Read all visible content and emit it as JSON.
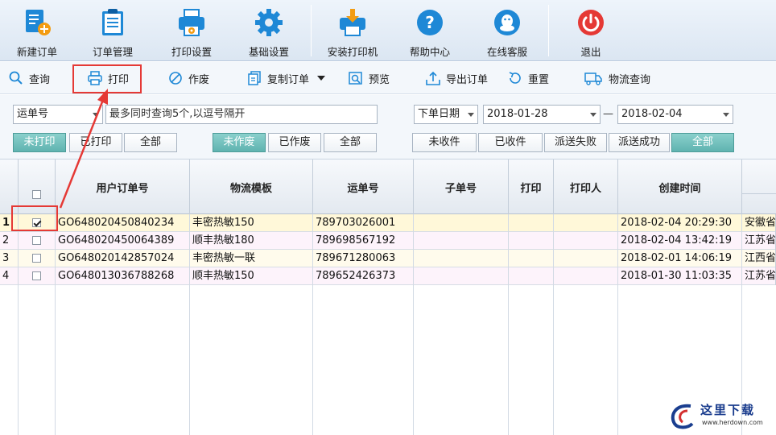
{
  "toolbar": {
    "buttons": [
      {
        "label": "新建订单",
        "icon": "new-order-icon"
      },
      {
        "label": "订单管理",
        "icon": "clipboard-icon"
      },
      {
        "label": "打印设置",
        "icon": "printer-settings-icon"
      },
      {
        "label": "基础设置",
        "icon": "gear-icon"
      },
      {
        "label": "安装打印机",
        "icon": "install-printer-icon"
      },
      {
        "label": "帮助中心",
        "icon": "help-icon"
      },
      {
        "label": "在线客服",
        "icon": "chat-icon"
      },
      {
        "label": "退出",
        "icon": "power-icon"
      }
    ]
  },
  "actions": {
    "query": "查询",
    "print": "打印",
    "void": "作废",
    "copy_order": "复制订单",
    "preview": "预览",
    "export_order": "导出订单",
    "reset": "重置",
    "logistics_query": "物流查询"
  },
  "filters": {
    "search_field": "运单号",
    "search_placeholder": "最多同时查询5个,以逗号隔开",
    "date_field": "下单日期",
    "date_from": "2018-01-28",
    "date_sep": "—",
    "date_to": "2018-02-04",
    "print_status": {
      "unprinted": "未打印",
      "printed": "已打印",
      "all": "全部",
      "selected": "未打印"
    },
    "void_status": {
      "not_void": "未作废",
      "void": "已作废",
      "all": "全部",
      "selected": "未作废"
    },
    "delivery_status": {
      "not_received": "未收件",
      "received": "已收件",
      "failed": "派送失败",
      "success": "派送成功",
      "all": "全部",
      "selected": "全部"
    }
  },
  "table": {
    "columns": [
      "用户订单号",
      "物流模板",
      "运单号",
      "子单号",
      "打印",
      "打印人",
      "创建时间"
    ],
    "rows": [
      {
        "num": "1",
        "checked": true,
        "order": "GO648020450840234",
        "template": "丰密热敏150",
        "waybill": "789703026001",
        "sub": "",
        "print": "",
        "printer": "",
        "created": "2018-02-04 20:29:30",
        "extra": "安徽省"
      },
      {
        "num": "2",
        "checked": false,
        "order": "GO648020450064389",
        "template": "顺丰热敏180",
        "waybill": "789698567192",
        "sub": "",
        "print": "",
        "printer": "",
        "created": "2018-02-04 13:42:19",
        "extra": "江苏省"
      },
      {
        "num": "3",
        "checked": false,
        "order": "GO648020142857024",
        "template": "丰密热敏一联",
        "waybill": "789671280063",
        "sub": "",
        "print": "",
        "printer": "",
        "created": "2018-02-01 14:06:19",
        "extra": "江西省"
      },
      {
        "num": "4",
        "checked": false,
        "order": "GO648013036788268",
        "template": "顺丰热敏150",
        "waybill": "789652426373",
        "sub": "",
        "print": "",
        "printer": "",
        "created": "2018-01-30 11:03:35",
        "extra": "江苏省"
      }
    ]
  },
  "watermark": {
    "text": "这里下载",
    "url": "www.herdown.com"
  },
  "colors": {
    "accent": "#5fb3b0",
    "highlight": "#e53935"
  }
}
